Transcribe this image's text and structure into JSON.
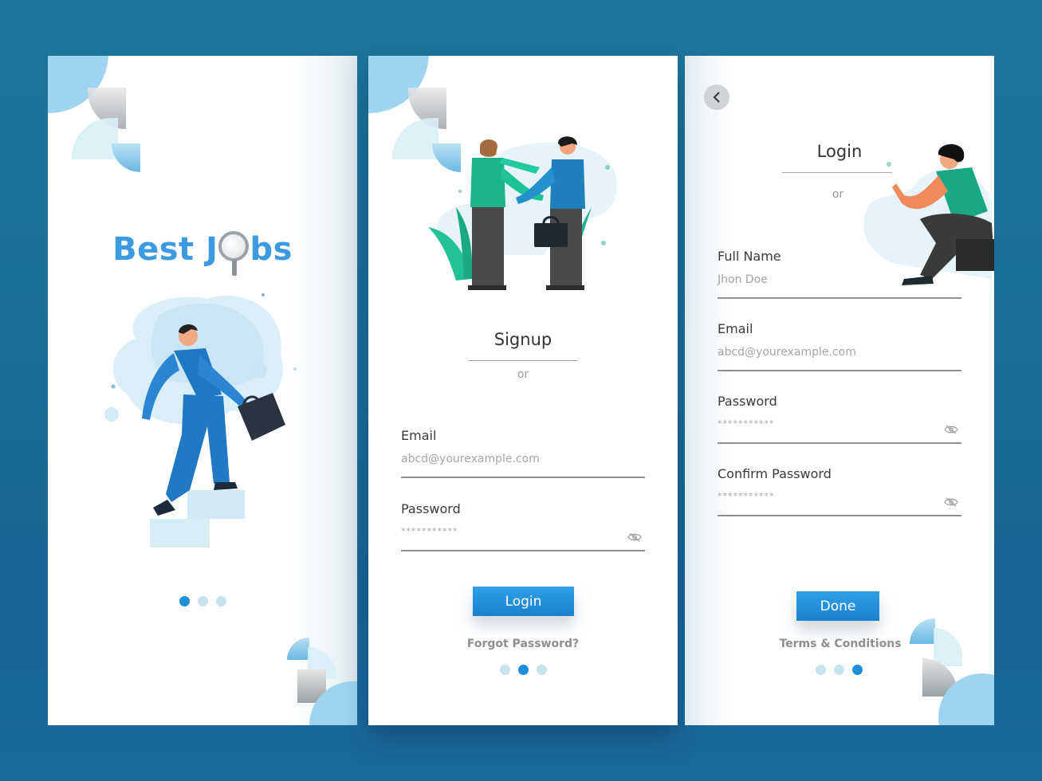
{
  "screens": [
    {
      "name": "splash",
      "brand": {
        "text_before": "Best J",
        "text_after": "bs",
        "icon": "magnifier-icon"
      },
      "illustration": "businessman-climbing-stairs-with-briefcase",
      "pager": {
        "count": 3,
        "active": 1
      }
    },
    {
      "name": "signup",
      "illustration": "two-men-shaking-hands",
      "title": "Signup",
      "or_text": "or",
      "fields": [
        {
          "label": "Email",
          "placeholder": "abcd@yourexample.com"
        },
        {
          "label": "Password",
          "placeholder": "***********",
          "icon": "eye-slash-icon"
        }
      ],
      "primary_button": "Login",
      "secondary_link": "Forgot Password?",
      "pager": {
        "count": 3,
        "active": 2
      }
    },
    {
      "name": "login",
      "back_icon": "chevron-left-icon",
      "illustration": "seated-person-pointing",
      "title": "Login",
      "or_text": "or",
      "fields": [
        {
          "label": "Full Name",
          "placeholder": "Jhon Doe"
        },
        {
          "label": "Email",
          "placeholder": "abcd@yourexample.com"
        },
        {
          "label": "Password",
          "placeholder": "***********",
          "icon": "eye-slash-icon"
        },
        {
          "label": "Confirm Password",
          "placeholder": "***********",
          "icon": "eye-slash-icon"
        }
      ],
      "primary_button": "Done",
      "secondary_link": "Terms & Conditions",
      "pager": {
        "count": 3,
        "active": 3
      }
    }
  ],
  "colors": {
    "background": "#1b6f98",
    "accent": "#1e8fd8",
    "brand_text": "#3b9ae0",
    "dot_inactive": "#c6e3ee"
  }
}
